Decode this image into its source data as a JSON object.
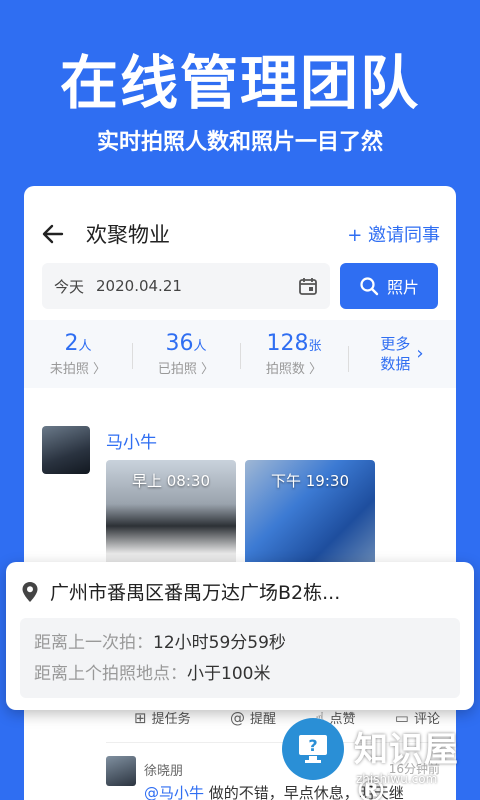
{
  "hero": {
    "title": "在线管理团队",
    "subtitle": "实时拍照人数和照片一目了然"
  },
  "header": {
    "back_icon": "arrow-left-icon",
    "org_name": "欢聚物业",
    "invite_label": "+ 邀请同事"
  },
  "search": {
    "date_prefix": "今天",
    "date_value": "2020.04.21",
    "calendar_icon": "calendar-icon",
    "button_label": "照片",
    "button_icon": "search-icon"
  },
  "stats": [
    {
      "num": "2",
      "unit": "人",
      "label": "未拍照 〉"
    },
    {
      "num": "36",
      "unit": "人",
      "label": "已拍照 〉"
    },
    {
      "num": "128",
      "unit": "张",
      "label": "拍照数 〉"
    }
  ],
  "stats_more": {
    "line1": "更多",
    "line2": "数据"
  },
  "feed": {
    "name": "马小牛",
    "photos": [
      {
        "label": "早上 08:30"
      },
      {
        "label": "下午 19:30"
      }
    ],
    "actions": [
      {
        "icon": "task-icon",
        "label": "提任务"
      },
      {
        "icon": "at-icon",
        "label": "提醒"
      },
      {
        "icon": "thumb-up-icon",
        "label": "点赞"
      },
      {
        "icon": "comment-icon",
        "label": "评论"
      }
    ],
    "comment": {
      "author": "徐晓朋",
      "time": "16分钟前",
      "mention": "@马小牛",
      "text": "做的不错，早点休息，明天继"
    }
  },
  "popup": {
    "location_icon": "location-pin-icon",
    "location": "广州市番禺区番禺万达广场B2栋...",
    "rows": [
      {
        "key": "距离上一次拍：",
        "value": "12小时59分59秒"
      },
      {
        "key": "距离上个拍照地点：",
        "value": "小于100米"
      }
    ]
  },
  "watermark": {
    "title": "知识屋®",
    "url": "zhishiwu.com"
  },
  "colors": {
    "accent": "#2f6ef2",
    "background": "#2f6ef2"
  }
}
